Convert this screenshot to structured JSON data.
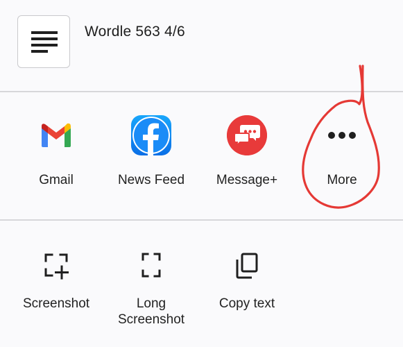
{
  "share_sheet": {
    "title": "Wordle 563 4/6",
    "preview_icon": "text-lines-icon"
  },
  "apps": [
    {
      "label": "Gmail",
      "icon": "gmail-icon"
    },
    {
      "label": "News Feed",
      "icon": "facebook-icon"
    },
    {
      "label": "Message+",
      "icon": "message-plus-icon"
    },
    {
      "label": "More",
      "icon": "more-horizontal-icon"
    }
  ],
  "actions": [
    {
      "label": "Screenshot",
      "icon": "screenshot-icon"
    },
    {
      "label_line1": "Long",
      "label_line2": "Screenshot",
      "icon": "long-screenshot-icon"
    },
    {
      "label": "Copy text",
      "icon": "copy-icon"
    }
  ],
  "colors": {
    "background": "#fafafc",
    "divider": "#d7d7da",
    "facebook": "#1877f2",
    "message_plus": "#e83a3a",
    "annotation": "#e53935"
  }
}
